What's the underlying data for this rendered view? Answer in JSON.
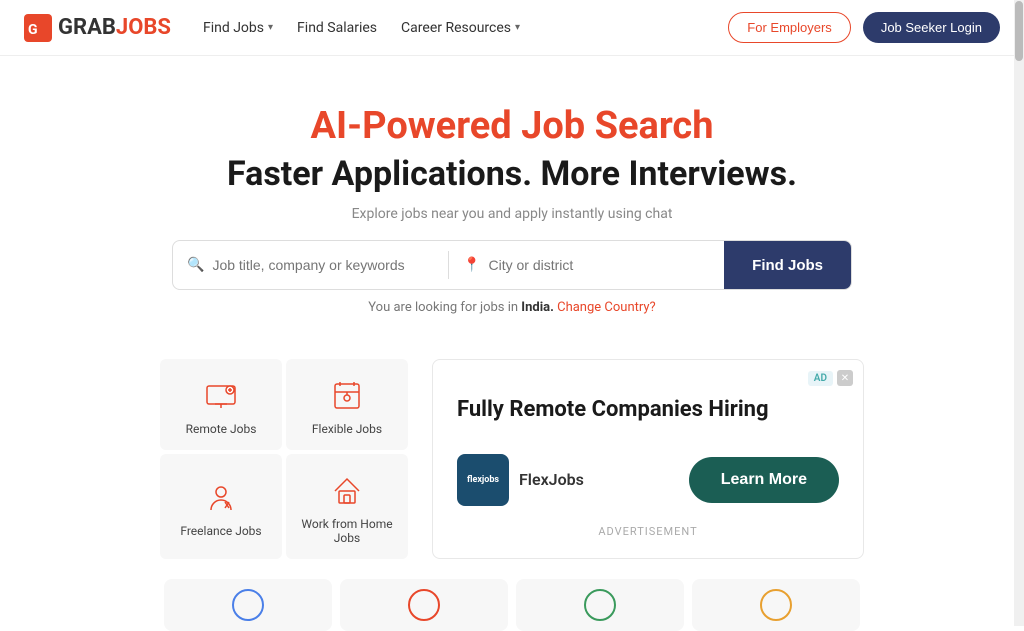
{
  "logo": {
    "grab": "GRAB",
    "jobs": "JOBS"
  },
  "navbar": {
    "links": [
      {
        "label": "Find Jobs",
        "hasDropdown": true
      },
      {
        "label": "Find Salaries",
        "hasDropdown": false
      },
      {
        "label": "Career Resources",
        "hasDropdown": true
      }
    ],
    "employers_btn": "For Employers",
    "login_btn": "Job Seeker Login"
  },
  "hero": {
    "title_red": "AI-Powered Job Search",
    "title_black": "Faster Applications. More Interviews.",
    "subtitle": "Explore jobs near you and apply instantly using chat"
  },
  "search": {
    "job_placeholder": "Job title, company or keywords",
    "location_placeholder": "City or district",
    "find_btn": "Find Jobs",
    "location_note": "You are looking for jobs in",
    "country": "India.",
    "change_link": "Change Country?"
  },
  "categories": [
    {
      "label": "Remote Jobs",
      "icon": "remote"
    },
    {
      "label": "Flexible Jobs",
      "icon": "flexible"
    },
    {
      "label": "Freelance Jobs",
      "icon": "freelance"
    },
    {
      "label": "Work from Home Jobs",
      "icon": "wfh"
    }
  ],
  "ad": {
    "badge": "AD",
    "title": "Fully Remote Companies Hiring",
    "logo_text": "flexjobs",
    "brand_name": "FlexJobs",
    "learn_more": "Learn More",
    "footer": "ADVERTISEMENT"
  }
}
